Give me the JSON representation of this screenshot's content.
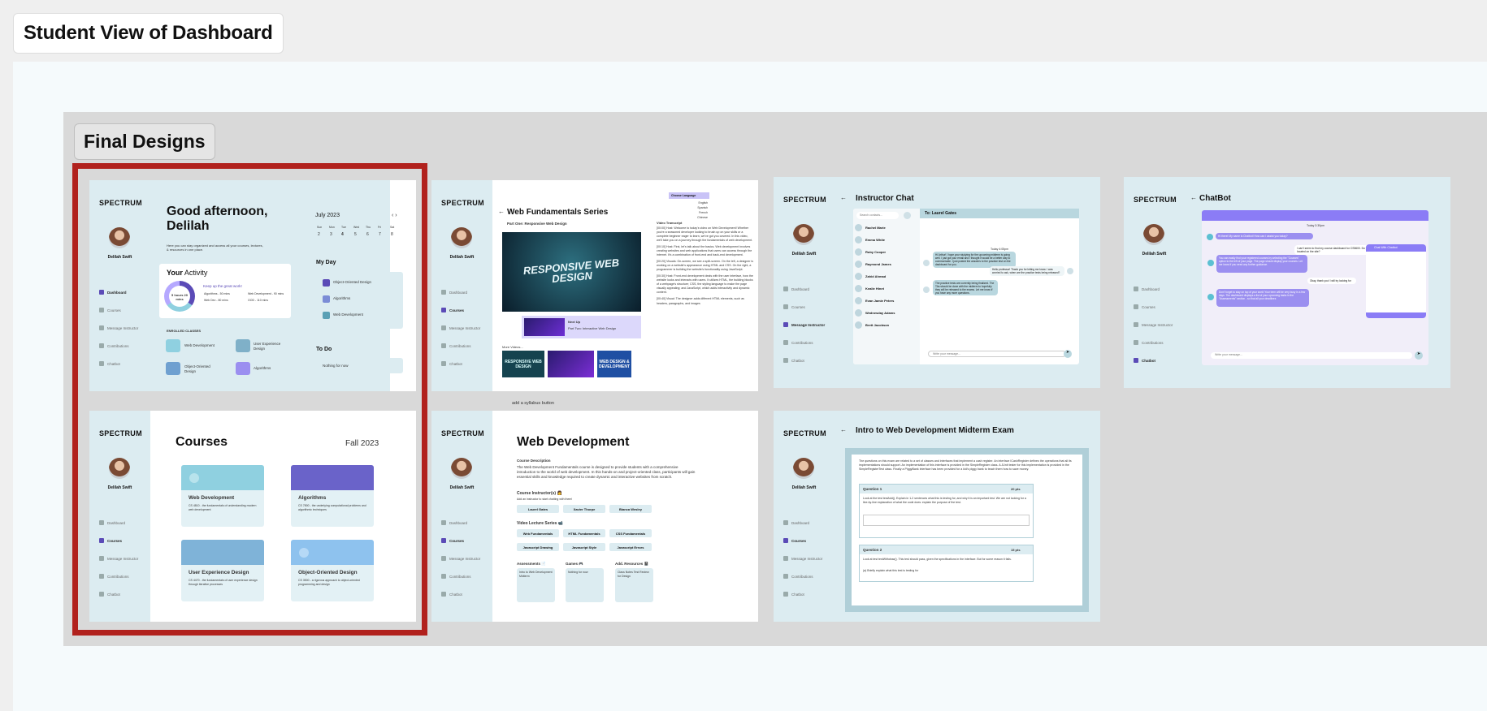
{
  "page_title": "Student View of Dashboard",
  "section_title": "Final Designs",
  "annotation": "add a syllabus button",
  "brand": "SPECTRUM",
  "user_name": "Delilah Swift",
  "nav": {
    "dashboard": "Dashboard",
    "courses": "Courses",
    "message": "Message Instructor",
    "contributions": "Contributions",
    "chatbot": "Chatbot"
  },
  "dashboard": {
    "greeting": "Good afternoon, Delilah",
    "subtitle": "Here you can stay organized and access all your courses, lectures, & resources in one place.",
    "activity_title": "Your Activity",
    "activity_prefix": "Your",
    "activity_word": "Activity",
    "activity_msg": "Keep up the great work!",
    "activity_total": "5 hours 20 mins",
    "legend": [
      "Algorithms - 50 mins",
      "Web Development - 90 mins",
      "Web Dev - 80 mins",
      "OOD - 110 mins"
    ],
    "enrolled_label": "ENROLLED CLASSES",
    "classes": [
      "Web Development",
      "User Experience Design",
      "Object-Oriented Design",
      "Algorithms"
    ],
    "month": "July 2023",
    "weekdays": [
      "Sun",
      "Mon",
      "Tue",
      "Wed",
      "Thu",
      "Fri",
      "Sat"
    ],
    "dates": [
      "2",
      "3",
      "4",
      "5",
      "6",
      "7",
      "8"
    ],
    "myday": "My Day",
    "events": [
      "Object-Oriented Design",
      "Algorithms",
      "Web Development"
    ],
    "todo": "To Do",
    "todo_empty": "Nothing for now"
  },
  "courses": {
    "title": "Courses",
    "term": "Fall 2023",
    "cards": [
      {
        "name": "Web Development",
        "desc": "CS 4810 - the fundamentals of understanding modern web development"
      },
      {
        "name": "Algorithms",
        "desc": "CS 7800 - the underlying computational problems and algorithmic techniques"
      },
      {
        "name": "User Experience Design",
        "desc": "CS 4470 - the fundamentals of user experience design through iterative processes"
      },
      {
        "name": "Object-Oriented Design",
        "desc": "CS 3500 - a rigorous approach to object-oriented programming and design"
      }
    ]
  },
  "video": {
    "title": "Web Fundamentals Series",
    "part": "Part One: Responsive Web Design",
    "video_text": "RESPONSIVE WEB DESIGN",
    "up_next_label": "Next Up",
    "up_next": "Part Two: Interactive Web Design",
    "more": "More Videos...",
    "thumbs": [
      "RESPONSIVE WEB DESIGN",
      "",
      "WEB DESIGN & DEVELOPMENT"
    ],
    "lang_label": "Choose Language",
    "langs": [
      "English",
      "Spanish",
      "French",
      "Chinese"
    ],
    "transcript_title": "Video Transcript",
    "transcript": [
      "[00:00] Host: Welcome to today's video on Web Development! Whether you're a seasoned developer looking to brush up on your skills or a complete beginner eager to learn, we've got you covered. In this video, we'll take you on a journey through the fundamentals of web development.",
      "[00:10] Host: First, let's talk about the basics. Web development involves creating websites and web applications that users can access through the internet. It's a combination of front-end and back-end development.",
      "[00:20] Visuals: On-screen, we see a split-screen. On the left, a designer is working on a website's appearance using HTML and CSS. On the right, a programmer is building the website's functionality using JavaScript.",
      "[00:30] Host: Front-end development deals with the user interface, how the website looks and interacts with users. It utilizes HTML, the building blocks of a webpage's structure; CSS, the styling language to make the page visually appealing; and JavaScript, which adds interactivity and dynamic content.",
      "[00:40] Visual: The designer adds different HTML elements, such as headers, paragraphs, and images"
    ]
  },
  "chat": {
    "title": "Instructor Chat",
    "search": "Search contacts...",
    "to": "To: Laurel Gates",
    "contacts": [
      "Rachel Marie",
      "Emma White",
      "Ruby Cooper",
      "Raymond James",
      "Zahid Ahmad",
      "Kealie Hinet",
      "Evan Jamie Peters",
      "Wednesday Adams",
      "Brett Jacobson"
    ],
    "day": "Today 4:05pm",
    "messages": [
      "Hi Arthur! I hope your studying for the upcoming midterm is going well. I just got your email and I thought it would be a better way to communicate. I just posted the answers to the practice test on the dashboard for you.",
      "Hello professor! Thank you for letting me know. I was worried to ask, when are the practice tests being released?",
      "The practice tests are currently being finalized. The TAs should be done with the midterm to hopefully they will be released to the exams. Let me know if you have any more questions."
    ],
    "input": "Write your message..."
  },
  "chatbot": {
    "title": "ChatBot",
    "day": "Today 3:30pm",
    "messages": [
      "Hi there! My name is Chatbot! How can I assist you today?",
      "I can't seem to find my course dashboard for CS5600. Do you know where it is located on the site?",
      "You can easily find your registered courses by selecting the \"Courses\" option to the left of your page. The page should display your courses. Let me know if you need any further guidance.",
      "Okay, thank you! I will try looking for",
      "Don't forget to stay on top of your work! Your term will be very busy in a few days. The dashboard displays a list of your upcoming tasks in the \"Assessments\" section - so that all your deadlines"
    ],
    "popup": "Chat With Chatbot",
    "input": "Write your message..."
  },
  "webdev": {
    "title": "Web Development",
    "desc_label": "Course Description",
    "desc": "The Web Development Fundamentals course is designed to provide students with a comprehensive introduction to the world of web development. In this hands-on and project-oriented class, participants will gain essential skills and knowledge required to create dynamic and interactive websites from scratch.",
    "instructors_label": "Course Instructor(s) 👩",
    "instructors_sub": "Add an instructor to start chatting with them!",
    "instructors": [
      "Laurel Gates",
      "Xavier Thorpe",
      "Bianca Wesley"
    ],
    "lectures_label": "Video Lecture Series 📹",
    "lectures": [
      "Web Fundamentals",
      "HTML Fundamentals",
      "CSS Fundamentals",
      "Javascript Drawing",
      "Javascript Style",
      "Javascript Errors"
    ],
    "assess_label": "Assessments 📄",
    "assess": "Intro to Web Development Midterm",
    "games_label": "Games 🎮",
    "games": "Nothing for now",
    "res_label": "Add. Resources 📓",
    "res": "Class Notes Test Review for Design"
  },
  "exam": {
    "title": "Intro to Web Development Midterm Exam",
    "intro": "The questions on this exam are related to a set of classes and interfaces that implement a cash register. An interface ICashRegister defines the operations that all its implementations should support. An implementation of this interface is provided in the SimpleRegister class. A JUnit tester for this implementation is provided in the SimpleRegisterTest class. Finally a PiggyBank interface has been provided for a kid's piggy bank to teach them how to save money.",
    "q1": "Question 1",
    "q1_pts": "20 pts",
    "q1_text": "Look at the test testAdd(). Explain in 1-2 sentences what this is testing for, and why it is an important test. We are not looking for a line-by-line explanation of what the code does: explain the purpose of the test.",
    "q2": "Question 2",
    "q2_pts": "15 pts",
    "q2_text": "Look at test testWithdraw(). This test should pass, given the specifications in the interface. But for some reason it fails.",
    "q2_sub": "(a) Briefly explain what this test is testing for"
  },
  "colors": {
    "accent": "#5b4bb7",
    "panel": "#dcecf1",
    "selection": "#b1211d",
    "purple": "#8b7cf6"
  }
}
